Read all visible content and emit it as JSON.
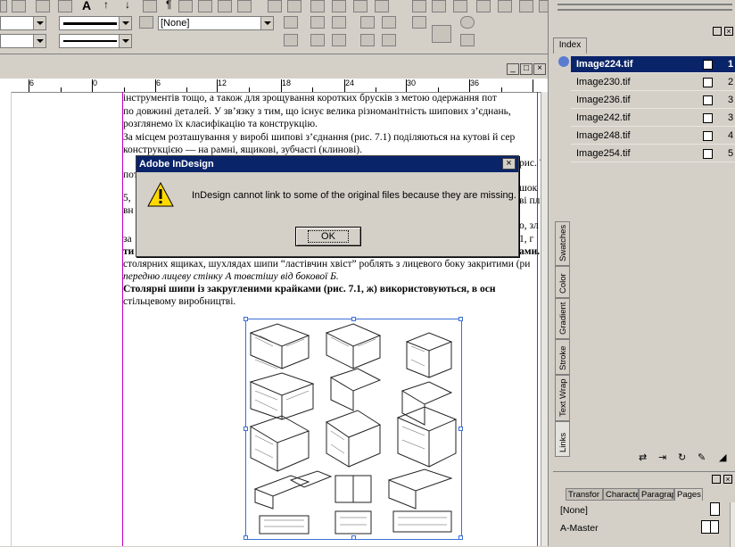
{
  "control_panel": {
    "object_style": "[None]"
  },
  "ruler": {
    "ticks": [
      "6",
      "0",
      "6",
      "12",
      "18",
      "24",
      "30",
      "36"
    ]
  },
  "document": {
    "lines_top": [
      "інструментів тощо, а також для зрощування коротких брусків з метою одержання пот",
      "по довжині деталей. У зв’язку з тим, що існує велика різноманітність шипових з’єднань,",
      "розглянемо їх класифікацію та конструкцію.",
      "    За місцем розташування у виробі шипові з’єднання (рис. 7.1) поділяються на кутові й сер",
      "конструкцією — на рамні, ящикові, зубчасті (клинові)."
    ],
    "lines_mid": [
      "столярних ящиках, шухлядах шипи “ластівчин хвіст” роблять з лицевого боку закритими (ри",
      "передню лицеву стінку А товстішу від бокової Б."
    ],
    "lines_bottom": [
      "    Столярні шипи із закругленими крайками (рис. 7.1, ж) використовуються, в осн",
      "стільцевому виробництві."
    ],
    "fragments": {
      "frag_po": "пот",
      "frag_5": "5,",
      "frag_vn": "вн",
      "frag_za": "за",
      "frag_ti": "ти",
      "frag_ris": "рис. 7",
      "frag_shok": "шок",
      "frag_pl": "ві пл",
      "frag_zl": "о, зл",
      "frag_r1": "1, г",
      "frag_mi": "ами."
    }
  },
  "dialog": {
    "title": "Adobe InDesign",
    "message": "InDesign cannot link to some of the original files because they are missing.",
    "ok_label": "OK"
  },
  "panels": {
    "index_tab": "Index",
    "links": [
      {
        "name": "Image224.tif",
        "page": "1",
        "selected": true
      },
      {
        "name": "Image230.tif",
        "page": "2",
        "selected": false
      },
      {
        "name": "Image236.tif",
        "page": "3",
        "selected": false
      },
      {
        "name": "Image242.tif",
        "page": "3",
        "selected": false
      },
      {
        "name": "Image248.tif",
        "page": "4",
        "selected": false
      },
      {
        "name": "Image254.tif",
        "page": "5",
        "selected": false
      }
    ],
    "side_tabs": [
      "Links",
      "Text Wrap",
      "Stroke",
      "Gradient",
      "Color",
      "Swatches"
    ],
    "bottom_tabs": [
      "Transfor",
      "Characte",
      "Paragrap",
      "Pages"
    ],
    "pages": {
      "none": "[None]",
      "master": "A-Master"
    }
  },
  "colors": {
    "selection": "#0a246a",
    "frame": "#3b6fd6",
    "margin_guide": "#c000c0"
  }
}
